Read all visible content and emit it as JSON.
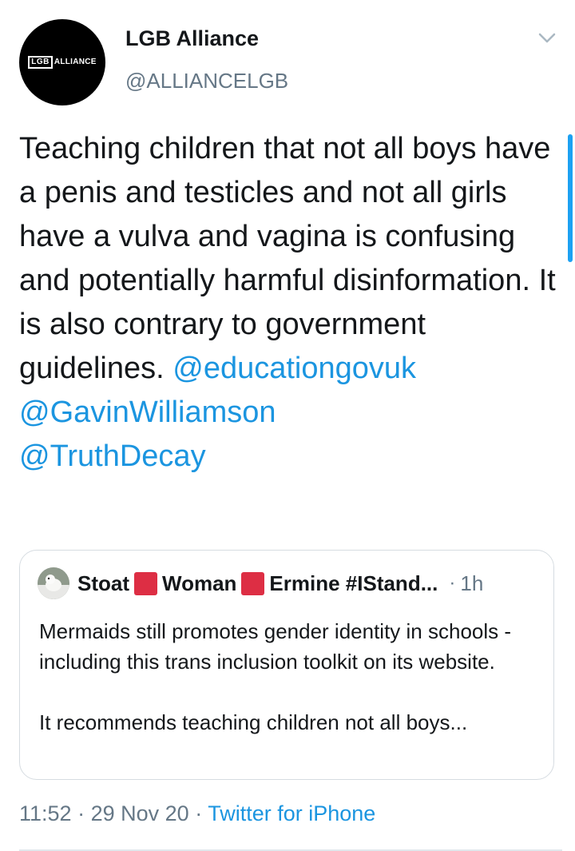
{
  "author": {
    "name": "LGB Alliance",
    "handle": "@ALLIANCELGB",
    "avatar_logo": {
      "boxed": "LGB",
      "word": "ALLIANCE"
    }
  },
  "menu_icon": "chevron-down-icon",
  "tweet": {
    "text": "Teaching children that not all boys have a penis and testicles and not all girls have a vulva and vagina is confusing and potentially harmful disinformation. It is also contrary to government guidelines.",
    "mentions": [
      "@educationgovuk",
      "@GavinWilliamson",
      "@TruthDecay"
    ]
  },
  "quoted_tweet": {
    "name_parts": [
      "Stoat",
      "Woman",
      "Ermine #IStand..."
    ],
    "separator_icon": "red-square-emoji",
    "dot": "·",
    "time": "1h",
    "paragraph_1": "Mermaids still promotes gender identity in schools - including this trans inclusion toolkit on its website.",
    "paragraph_2": "It recommends teaching children not all boys..."
  },
  "meta": {
    "time": "11:52",
    "sep1": "·",
    "date": "29 Nov 20",
    "sep2": "·",
    "source": "Twitter for iPhone"
  },
  "colors": {
    "link": "#1b95e0",
    "secondary_text": "#657786",
    "primary_text": "#14171a",
    "emoji_red": "#dd2e44",
    "scrollbar": "#1da1f2"
  }
}
